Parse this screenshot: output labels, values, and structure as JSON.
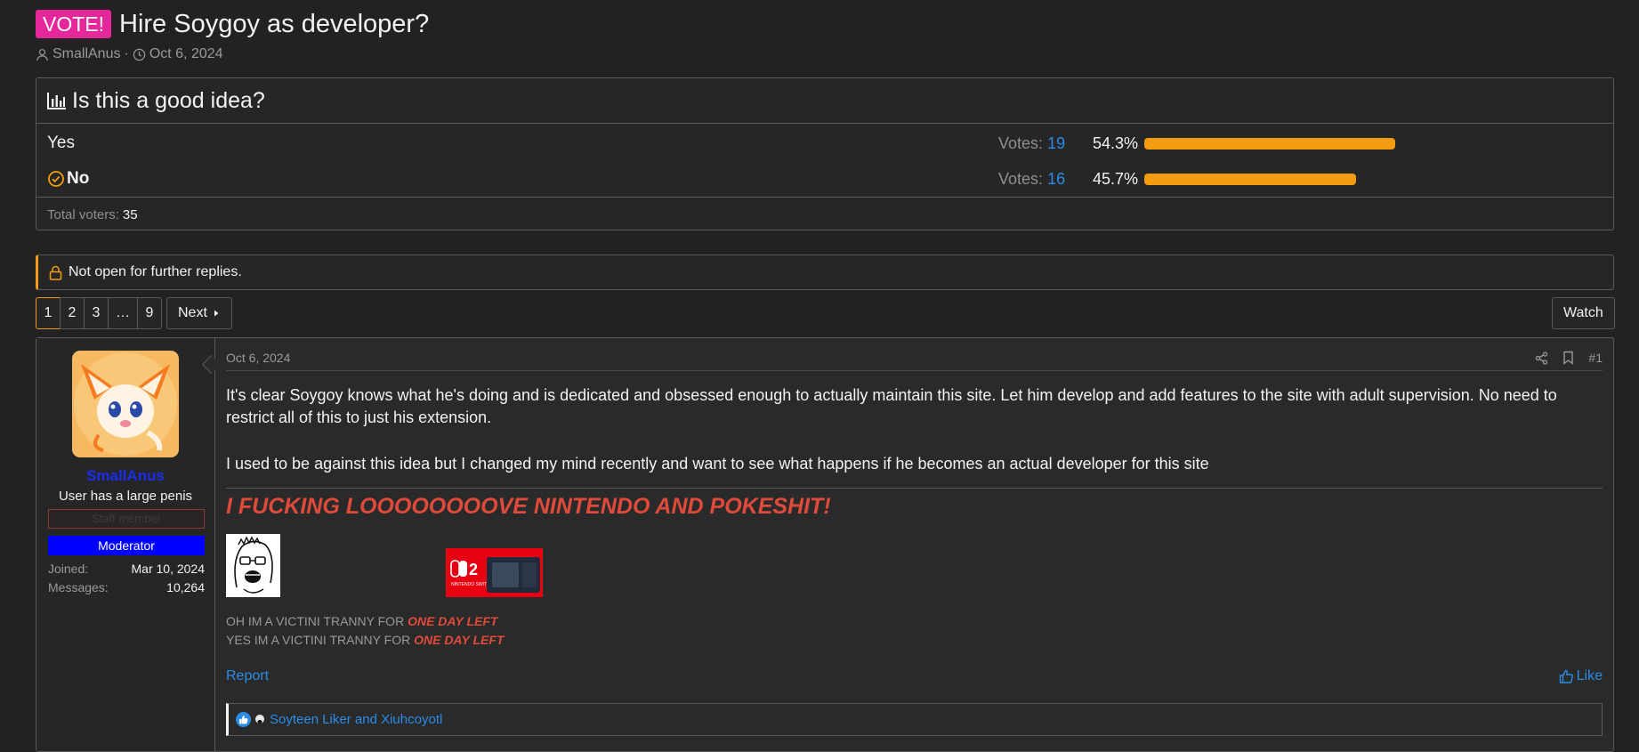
{
  "thread": {
    "prefix": "VOTE!",
    "title": "Hire Soygoy as developer?",
    "author": "SmallAnus",
    "separator": "·",
    "date": "Oct 6, 2024"
  },
  "poll": {
    "question": "Is this a good idea?",
    "votes_label": "Votes:",
    "options": [
      {
        "label": "Yes",
        "votes": "19",
        "percent": "54.3%",
        "fraction": 0.543,
        "selected": false
      },
      {
        "label": "No",
        "votes": "16",
        "percent": "45.7%",
        "fraction": 0.457,
        "selected": true
      }
    ],
    "total_label": "Total voters:",
    "total": "35"
  },
  "notice": "Not open for further replies.",
  "pagination": {
    "pages": [
      "1",
      "2",
      "3",
      "…",
      "9"
    ],
    "current": "1",
    "next": "Next",
    "watch": "Watch"
  },
  "post": {
    "user": {
      "name": "SmallAnus",
      "title": "User has a large penis",
      "staff_banner": "Staff member",
      "role_banner": "Moderator",
      "joined_label": "Joined:",
      "joined": "Mar 10, 2024",
      "messages_label": "Messages:",
      "messages": "10,264"
    },
    "date": "Oct 6, 2024",
    "number": "#1",
    "paragraph1": "It's clear Soygoy knows what he's doing and is dedicated and obsessed enough to actually maintain this site. Let him develop and add features to the site with adult supervision. No need to restrict all of this to just his extension.",
    "paragraph2": "I used to be against this idea but I changed my mind recently and want to see what happens if he becomes an actual developer for this site",
    "signature": {
      "headline": "I FUCKING LOOOOOOOOVE NINTENDO AND POKESHIT!",
      "line1_prefix": "OH IM A VICTINI TRANNY FOR ",
      "line1_highlight": "ONE DAY LEFT",
      "line2_prefix": "YES IM A VICTINI TRANNY FOR ",
      "line2_highlight": "ONE DAY LEFT",
      "switch_text": "NINTENDO SWITCH"
    },
    "report": "Report",
    "like": "Like",
    "reactions": "Soyteen Liker and Xiuhcoyotl"
  },
  "colors": {
    "accent": "#f29c0f",
    "link": "#2b8ce8",
    "vote_badge": "#e6279a",
    "moderator": "#0000ff",
    "signature_red": "#e04a3a"
  }
}
